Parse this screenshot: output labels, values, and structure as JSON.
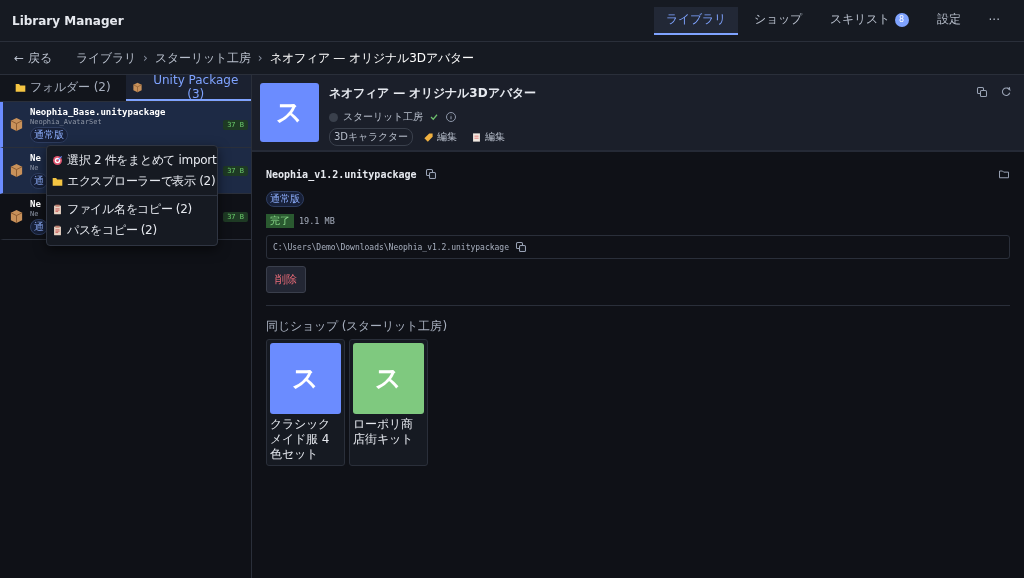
{
  "app": {
    "title": "Library Manager"
  },
  "nav": [
    {
      "label": "ライブラリ",
      "selected": true
    },
    {
      "label": "ショップ",
      "selected": false
    },
    {
      "label": "スキリスト",
      "selected": false,
      "badge": "8"
    },
    {
      "label": "設定",
      "selected": false
    },
    {
      "label": "···",
      "selected": false
    }
  ],
  "breadcrumb": {
    "back": "← 戻る",
    "separator": "›",
    "items": [
      "ライブラリ",
      "スターリット工房",
      "ネオフィア — オリジナル3Dアバター"
    ]
  },
  "sidebar": {
    "tabs": [
      {
        "label": "フォルダー (2)",
        "selected": false
      },
      {
        "label": "Unity Package (3)",
        "selected": true
      }
    ],
    "items": [
      {
        "name": "Neophia_Base.unitypackage",
        "sub": "Neophia_AvatarSet",
        "badge": "通常版",
        "size": "37 B",
        "selected": true
      },
      {
        "name": "Ne",
        "sub": "Ne",
        "badge": "通",
        "size": "37 B",
        "selected": true
      },
      {
        "name": "Ne",
        "sub": "Ne",
        "badge": "通",
        "size": "37 B",
        "selected": false
      }
    ]
  },
  "context_menu": [
    {
      "label": "選択 2 件をまとめて import",
      "kind": "import"
    },
    {
      "label": "エクスプローラーで表示 (2)",
      "kind": "reveal"
    },
    {
      "kind": "separator"
    },
    {
      "label": "ファイル名をコピー (2)",
      "kind": "copy"
    },
    {
      "label": "パスをコピー (2)",
      "kind": "copy"
    }
  ],
  "product": {
    "thumb": "ス",
    "title": "ネオフィア — オリジナル3Dアバター",
    "shop": "スターリット工房",
    "verified": true,
    "tags": [
      {
        "label": "3Dキャラクター",
        "kind": "category"
      },
      {
        "label": "編集",
        "kind": "label"
      },
      {
        "label": "編集",
        "kind": "note"
      }
    ]
  },
  "file": {
    "name": "Neophia_v1.2.unitypackage",
    "badge": "通常版",
    "status": "完了",
    "size": "19.1 MB",
    "path": "C:\\Users\\Demo\\Downloads\\Neophia_v1.2.unitypackage",
    "delete": "削除"
  },
  "related": {
    "title": "同じショップ (スターリット工房)",
    "items": [
      {
        "thumb": "ス",
        "color": "#6b8cff",
        "name": "クラシックメイド服 4色セット"
      },
      {
        "thumb": "ス",
        "color": "#7fc97f",
        "name": "ローポリ商店街キット"
      }
    ]
  }
}
